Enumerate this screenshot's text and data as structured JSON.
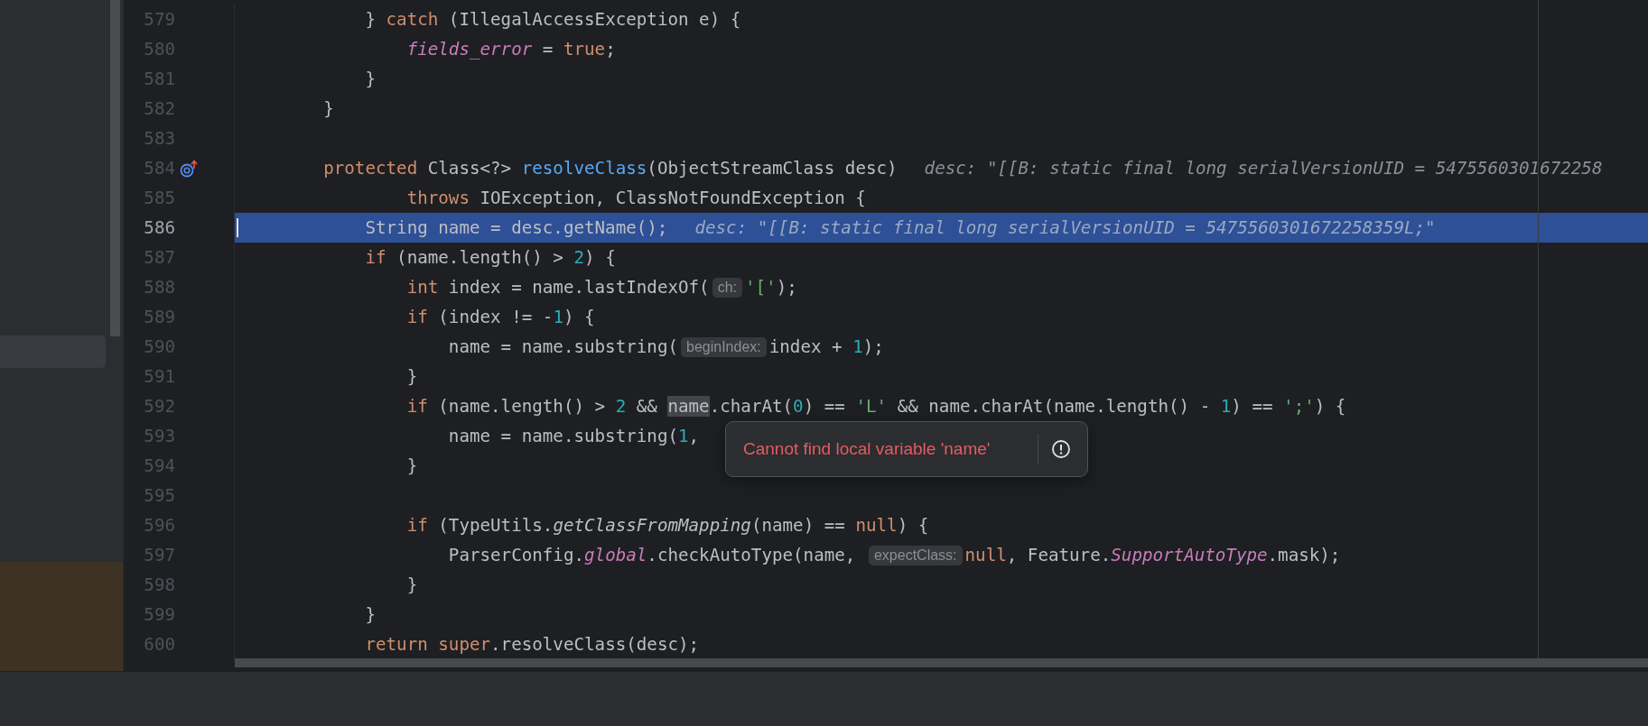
{
  "editor": {
    "lines": [
      {
        "number": "579",
        "kind": "code",
        "selected": false,
        "tokens": [
          {
            "kind": "plain",
            "text": "        } "
          },
          {
            "kind": "kw",
            "text": "catch"
          },
          {
            "kind": "plain",
            "text": " (IllegalAccessException e) {"
          }
        ]
      },
      {
        "number": "580",
        "kind": "code",
        "selected": false,
        "tokens": [
          {
            "kind": "field",
            "text": "            fields_error"
          },
          {
            "kind": "plain",
            "text": " = "
          },
          {
            "kind": "kw",
            "text": "true"
          },
          {
            "kind": "plain",
            "text": ";"
          }
        ]
      },
      {
        "number": "581",
        "kind": "code",
        "selected": false,
        "tokens": [
          {
            "kind": "plain",
            "text": "        }"
          }
        ]
      },
      {
        "number": "582",
        "kind": "code",
        "selected": false,
        "tokens": [
          {
            "kind": "plain",
            "text": "    }"
          }
        ]
      },
      {
        "number": "583",
        "kind": "code",
        "selected": false
      },
      {
        "number": "584",
        "kind": "override",
        "selected": false,
        "tokens": [
          {
            "kind": "kw",
            "text": "    protected"
          },
          {
            "kind": "plain",
            "text": " Class<?> "
          },
          {
            "kind": "decl",
            "text": "resolveClass"
          },
          {
            "kind": "plain",
            "text": "(ObjectStreamClass desc)"
          },
          {
            "kind": "value",
            "text": "desc: \"[[B: static final long serialVersionUID = 5475560301672258"
          }
        ]
      },
      {
        "number": "585",
        "kind": "code",
        "selected": false,
        "tokens": [
          {
            "kind": "kw",
            "text": "            throws"
          },
          {
            "kind": "plain",
            "text": " IOException, ClassNotFoundException {"
          }
        ]
      },
      {
        "number": "586",
        "kind": "code",
        "selected": true,
        "tokens": [
          {
            "kind": "plain",
            "text": "        String name = desc.getName();"
          },
          {
            "kind": "value",
            "text": "desc: \"[[B: static final long serialVersionUID = 5475560301672258359L;\""
          }
        ]
      },
      {
        "number": "587",
        "kind": "code",
        "selected": false,
        "tokens": [
          {
            "kind": "kw",
            "text": "        if"
          },
          {
            "kind": "plain",
            "text": " (name.length() > "
          },
          {
            "kind": "num",
            "text": "2"
          },
          {
            "kind": "plain",
            "text": ") {"
          }
        ]
      },
      {
        "number": "588",
        "kind": "code",
        "selected": false,
        "tokens": [
          {
            "kind": "kw",
            "text": "            int"
          },
          {
            "kind": "plain",
            "text": " index = name.lastIndexOf("
          },
          {
            "kind": "hint",
            "text": "ch:"
          },
          {
            "kind": "str",
            "text": "'['"
          },
          {
            "kind": "plain",
            "text": ");"
          }
        ]
      },
      {
        "number": "589",
        "kind": "code",
        "selected": false,
        "tokens": [
          {
            "kind": "kw",
            "text": "            if"
          },
          {
            "kind": "plain",
            "text": " (index != -"
          },
          {
            "kind": "num",
            "text": "1"
          },
          {
            "kind": "plain",
            "text": ") {"
          }
        ]
      },
      {
        "number": "590",
        "kind": "code",
        "selected": false,
        "tokens": [
          {
            "kind": "plain",
            "text": "                name = name.substring("
          },
          {
            "kind": "hint",
            "text": "beginIndex:"
          },
          {
            "kind": "plain",
            "text": "index + "
          },
          {
            "kind": "num",
            "text": "1"
          },
          {
            "kind": "plain",
            "text": ");"
          }
        ]
      },
      {
        "number": "591",
        "kind": "code",
        "selected": false,
        "tokens": [
          {
            "kind": "plain",
            "text": "            }"
          }
        ]
      },
      {
        "number": "592",
        "kind": "code",
        "selected": false,
        "tokens": [
          {
            "kind": "kw",
            "text": "            if"
          },
          {
            "kind": "plain",
            "text": " (name.length() > "
          },
          {
            "kind": "num",
            "text": "2"
          },
          {
            "kind": "plain",
            "text": " && "
          },
          {
            "kind": "ref",
            "text": "name"
          },
          {
            "kind": "plain",
            "text": ".charAt("
          },
          {
            "kind": "num",
            "text": "0"
          },
          {
            "kind": "plain",
            "text": ") == "
          },
          {
            "kind": "str",
            "text": "'L'"
          },
          {
            "kind": "plain",
            "text": " && name.charAt(name.length() - "
          },
          {
            "kind": "num",
            "text": "1"
          },
          {
            "kind": "plain",
            "text": ") == "
          },
          {
            "kind": "str",
            "text": "';'"
          },
          {
            "kind": "plain",
            "text": ") {"
          }
        ]
      },
      {
        "number": "593",
        "kind": "code",
        "selected": false,
        "tokens": [
          {
            "kind": "plain",
            "text": "                name = name.substring("
          },
          {
            "kind": "num",
            "text": "1"
          },
          {
            "kind": "plain",
            "text": ","
          }
        ]
      },
      {
        "number": "594",
        "kind": "code",
        "selected": false,
        "tokens": [
          {
            "kind": "plain",
            "text": "            }"
          }
        ]
      },
      {
        "number": "595",
        "kind": "code",
        "selected": false
      },
      {
        "number": "596",
        "kind": "code",
        "selected": false,
        "tokens": [
          {
            "kind": "kw",
            "text": "            if"
          },
          {
            "kind": "plain",
            "text": " (TypeUtils."
          },
          {
            "kind": "static",
            "text": "getClassFromMapping"
          },
          {
            "kind": "plain",
            "text": "(name) == "
          },
          {
            "kind": "kw",
            "text": "null"
          },
          {
            "kind": "plain",
            "text": ") {"
          }
        ]
      },
      {
        "number": "597",
        "kind": "code",
        "selected": false,
        "tokens": [
          {
            "kind": "plain",
            "text": "                ParserConfig."
          },
          {
            "kind": "field",
            "text": "global"
          },
          {
            "kind": "plain",
            "text": ".checkAutoType(name, "
          },
          {
            "kind": "hint",
            "text": "expectClass:"
          },
          {
            "kind": "kw",
            "text": "null"
          },
          {
            "kind": "plain",
            "text": ", Feature."
          },
          {
            "kind": "field",
            "text": "SupportAutoType"
          },
          {
            "kind": "plain",
            "text": ".mask);"
          }
        ]
      },
      {
        "number": "598",
        "kind": "code",
        "selected": false,
        "tokens": [
          {
            "kind": "plain",
            "text": "            }"
          }
        ]
      },
      {
        "number": "599",
        "kind": "code",
        "selected": false,
        "tokens": [
          {
            "kind": "plain",
            "text": "        }"
          }
        ]
      },
      {
        "number": "600",
        "kind": "code",
        "selected": false,
        "tokens": [
          {
            "kind": "kw",
            "text": "        return"
          },
          {
            "kind": "kw",
            "text": " super"
          },
          {
            "kind": "plain",
            "text": ".resolveClass(desc);"
          }
        ]
      }
    ]
  },
  "popup": {
    "kind": "error",
    "message": "Cannot find local variable 'name'"
  }
}
